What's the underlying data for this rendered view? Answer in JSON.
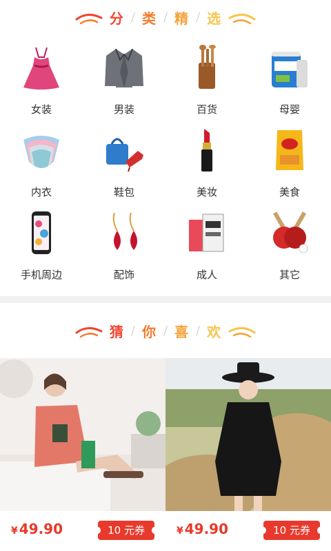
{
  "section1": {
    "chars": [
      "分",
      "类",
      "精",
      "选"
    ]
  },
  "categories": [
    {
      "label": "女装",
      "icon": "dress-icon"
    },
    {
      "label": "男装",
      "icon": "suit-jacket-icon"
    },
    {
      "label": "百货",
      "icon": "kitchen-utensils-icon"
    },
    {
      "label": "母婴",
      "icon": "formula-can-icon"
    },
    {
      "label": "内衣",
      "icon": "underwear-icon"
    },
    {
      "label": "鞋包",
      "icon": "handbag-shoes-icon"
    },
    {
      "label": "美妆",
      "icon": "lipstick-icon"
    },
    {
      "label": "美食",
      "icon": "chips-bag-icon"
    },
    {
      "label": "手机周边",
      "icon": "phone-case-icon"
    },
    {
      "label": "配饰",
      "icon": "earrings-icon"
    },
    {
      "label": "成人",
      "icon": "box-package-icon"
    },
    {
      "label": "其它",
      "icon": "ping-pong-icon"
    }
  ],
  "section2": {
    "chars": [
      "猜",
      "你",
      "喜",
      "欢"
    ]
  },
  "products": [
    {
      "currency": "¥",
      "price": "49.90",
      "coupon": "10 元券",
      "image": "woman-pink-top-photo"
    },
    {
      "currency": "¥",
      "price": "49.90",
      "coupon": "10 元券",
      "image": "woman-black-dress-hat-photo"
    }
  ]
}
